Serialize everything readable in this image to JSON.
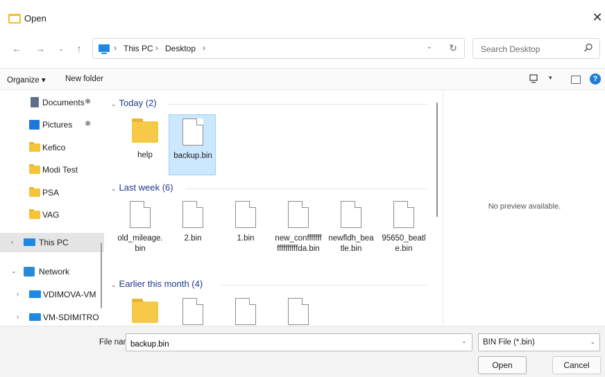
{
  "window": {
    "title": "Open",
    "close": "✕"
  },
  "nav": {
    "back": "←",
    "forward": "→",
    "recent": "⌄",
    "up": "↑",
    "breadcrumbs": [
      "This PC",
      "Desktop"
    ],
    "sep": "›",
    "dropdown": "⌄",
    "refresh": "↻",
    "search_placeholder": "Search Desktop"
  },
  "toolbar": {
    "organize": "Organize ▾",
    "new_folder": "New folder",
    "view_dd": "▾",
    "help": "?"
  },
  "sidebar": {
    "items": [
      {
        "label": "Documents",
        "pin": "✱",
        "icon": "documents-icon"
      },
      {
        "label": "Pictures",
        "pin": "✱",
        "icon": "pictures-icon"
      },
      {
        "label": "Kefico",
        "icon": "folder-icon"
      },
      {
        "label": "Modi Test",
        "icon": "folder-icon"
      },
      {
        "label": "PSA",
        "icon": "folder-icon"
      },
      {
        "label": "VAG",
        "icon": "folder-icon"
      },
      {
        "label": "This PC",
        "chev": "›",
        "icon": "pc-icon"
      },
      {
        "label": "Network",
        "chev": "⌄",
        "icon": "network-icon"
      },
      {
        "label": "VDIMOVA-VM",
        "chev": "›",
        "icon": "pc-icon"
      },
      {
        "label": "VM-SDIMITRO",
        "chev": "›",
        "icon": "pc-icon"
      }
    ]
  },
  "groups": [
    {
      "chev": "⌄",
      "label": "Today (2)"
    },
    {
      "chev": "⌄",
      "label": "Last week (6)"
    },
    {
      "chev": "⌄",
      "label": "Earlier this month (4)"
    }
  ],
  "files": {
    "today": [
      {
        "name": "help",
        "type": "folder"
      },
      {
        "name": "backup.bin",
        "type": "file",
        "selected": true
      }
    ],
    "last_week": [
      {
        "name": "old_mileage.bin",
        "type": "file"
      },
      {
        "name": "2.bin",
        "type": "file"
      },
      {
        "name": "1.bin",
        "type": "file"
      },
      {
        "name": "new_confffffffffffffffffda.bin",
        "type": "file"
      },
      {
        "name": "newfldh_beatle.bin",
        "type": "file"
      },
      {
        "name": "95650_beatle.bin",
        "type": "file"
      }
    ],
    "earlier": [
      {
        "type": "folder"
      },
      {
        "type": "file"
      },
      {
        "type": "file"
      },
      {
        "type": "file"
      }
    ]
  },
  "preview": {
    "message": "No preview available."
  },
  "bottom": {
    "file_name_label": "File name:",
    "file_name_value": "backup.bin",
    "dd": "⌄",
    "file_type": "BIN File (*.bin)",
    "open": "Open",
    "cancel": "Cancel"
  }
}
